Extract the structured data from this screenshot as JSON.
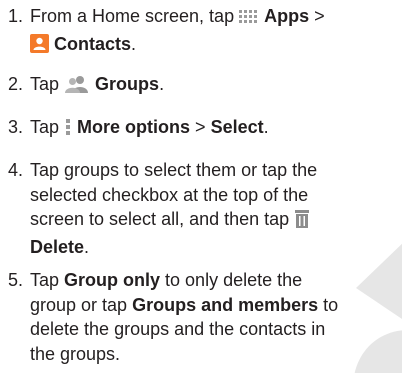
{
  "steps": [
    {
      "number": "1.",
      "line1_prefix": "From a Home screen, tap ",
      "apps_label": "Apps",
      "sep": " >",
      "contacts_label": "Contacts",
      "contacts_period": "."
    },
    {
      "number": "2.",
      "prefix": "Tap ",
      "groups_label": "Groups",
      "period": "."
    },
    {
      "number": "3.",
      "prefix": "Tap ",
      "more_label": "More options",
      "sep": " > ",
      "select_label": "Select",
      "period": "."
    },
    {
      "number": "4.",
      "line1": "Tap groups to select them or tap the",
      "line2": "selected checkbox at the top of the",
      "line3_prefix": "screen to select all, and then tap ",
      "delete_label": "Delete",
      "period": "."
    },
    {
      "number": "5.",
      "line1_prefix": "Tap ",
      "group_only_label": "Group only",
      "line1_suffix": " to only delete the",
      "line2_prefix": "group or tap ",
      "groups_members_label": "Groups and members",
      "line2_suffix": " to",
      "line3": "delete the groups and the contacts in",
      "line4": "the groups."
    }
  ],
  "icons": {
    "apps": "apps-grid-icon",
    "contacts": "contacts-icon",
    "groups": "groups-icon",
    "more": "more-options-icon",
    "delete": "trash-icon"
  },
  "colors": {
    "text": "#231f20",
    "contacts_icon": "#f47a2a",
    "icon_gray": "#9a9a9a",
    "delete_icon": "#8c8c8c",
    "watermark": "#e6e6e6"
  }
}
